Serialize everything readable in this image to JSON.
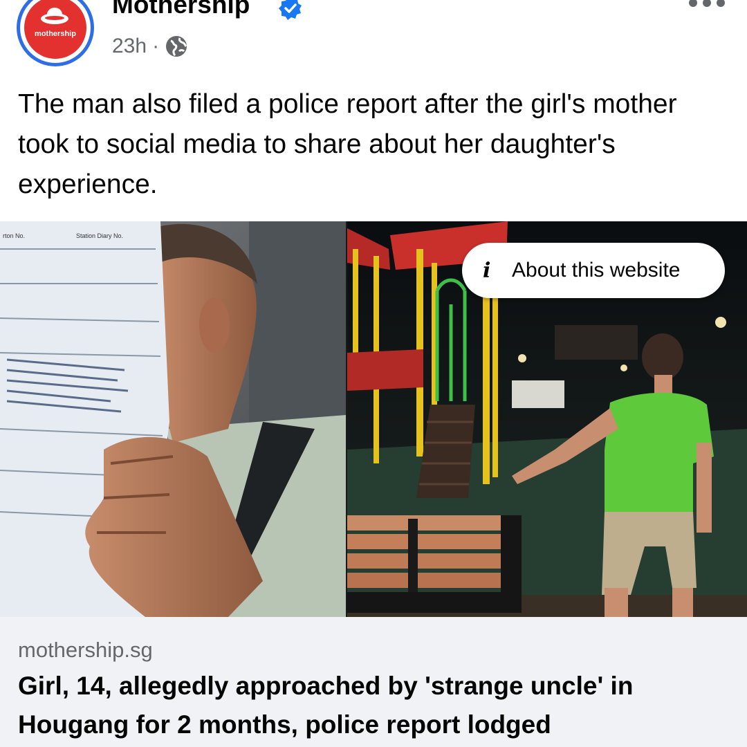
{
  "post": {
    "page_name": "Mothership",
    "avatar_text": "mothership",
    "timestamp": "23h",
    "separator": "·",
    "caption": "The man also filed a police report after the girl's mother took to social media to share about her daughter's experience."
  },
  "media": {
    "about_label": "About this website",
    "about_icon": "info-icon",
    "doc_text_1": "rton No.",
    "doc_text_2": "Station Diary No."
  },
  "link": {
    "domain": "mothership.sg",
    "headline": "Girl, 14, allegedly approached by 'strange uncle' in Hougang for 2 months, police report lodged"
  },
  "colors": {
    "brand_red": "#e2312e",
    "verified_blue": "#1877f2",
    "secondary_text": "#65676b",
    "preview_bg": "#f0f2f5"
  }
}
